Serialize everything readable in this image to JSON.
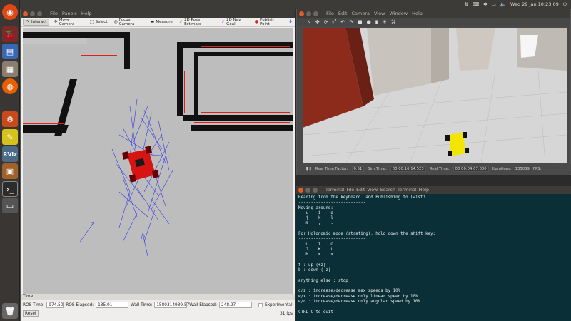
{
  "topbar": {
    "datetime": "Wed 29 Jan 10:23:09"
  },
  "launcher": {
    "items": [
      "ubuntu",
      "app-red",
      "app-blue",
      "app-files",
      "app-firefox",
      "app-settings",
      "app-notes",
      "rviz",
      "app-box",
      "terminal",
      "files-bottom",
      "trash"
    ],
    "rviz_label": "RViz"
  },
  "rviz": {
    "menu": [
      "File",
      "Panels",
      "Help"
    ],
    "tools": [
      "Interact",
      "Move Camera",
      "Select",
      "Focus Camera",
      "Measure",
      "2D Pose Estimate",
      "2D Nav Goal",
      "Publish Point"
    ],
    "time_panel_title": "Time",
    "ros_time_label": "ROS Time:",
    "ros_time": "974.50",
    "ros_elapsed_label": "ROS Elapsed:",
    "ros_elapsed": "135.01",
    "wall_time_label": "Wall Time:",
    "wall_time": "1580314989.57",
    "wall_elapsed_label": "Wall Elapsed:",
    "wall_elapsed": "248.97",
    "experimental_label": "Experimental",
    "reset_label": "Reset",
    "fps": "31 fps"
  },
  "gazebo": {
    "menu": [
      "File",
      "Edit",
      "Camera",
      "View",
      "Window",
      "Help"
    ],
    "rtf_label": "Real Time Factor:",
    "rtf": "0.51",
    "sim_time_label": "Sim Time:",
    "sim_time": "00 00:16:14.523",
    "real_time_label": "Real Time:",
    "real_time": "00 00:04:07.600",
    "iterations_label": "Iterations:",
    "iterations": "135059",
    "fps_label": "FPS:"
  },
  "terminal": {
    "title": "Terminal",
    "menu": [
      "File",
      "Edit",
      "View",
      "Search",
      "Terminal",
      "Help"
    ],
    "text": "Reading from the keyboard  and Publishing to Twist!\n---------------------------\nMoving around:\n   u    i    o\n   j    k    l\n   m    ,    .\n\nFor Holonomic mode (strafing), hold down the shift key:\n---------------------------\n   U    I    O\n   J    K    L\n   M    <    >\n\nt : up (+z)\nb : down (-z)\n\nanything else : stop\n\nq/z : increase/decrease max speeds by 10%\nw/x : increase/decrease only linear speed by 10%\ne/c : increase/decrease only angular speed by 10%\n\nCTRL-C to quit"
  },
  "colors": {
    "terminal_bg": "#0a2f36",
    "robot_red": "#d71414",
    "robot_yellow": "#f2e600",
    "map_wall": "#111111"
  }
}
